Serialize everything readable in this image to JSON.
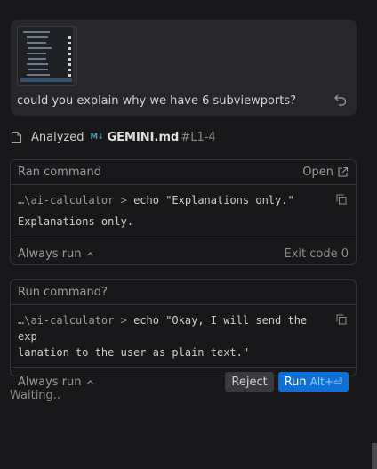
{
  "message": {
    "text": "could you explain why we have 6 subviewports?",
    "undo_icon": "undo-icon",
    "attachment": "scene-tree-thumbnail"
  },
  "analyzed": {
    "label": "Analyzed",
    "file_icon": "markdown-icon",
    "file_icon_text": "M↓",
    "file": "GEMINI.md",
    "range": "#L1-4"
  },
  "ran_command": {
    "title": "Ran command",
    "open_label": "Open",
    "path": "…\\ai-calculator",
    "prompt": ">",
    "command": "echo \"Explanations only.\"",
    "output": "Explanations only.",
    "always_run": "Always run",
    "exit_code": "Exit code 0"
  },
  "run_command": {
    "title": "Run command?",
    "path": "…\\ai-calculator",
    "prompt": ">",
    "command_line1": "echo \"Okay, I will send the exp",
    "command_line2": "lanation to the user as plain text.\"",
    "always_run": "Always run",
    "reject_label": "Reject",
    "run_label": "Run",
    "run_shortcut": "Alt+⏎"
  },
  "status": {
    "waiting": "Waiting.."
  },
  "colors": {
    "accent": "#0e70d4",
    "background": "#18181b",
    "bubble": "#27272b"
  }
}
